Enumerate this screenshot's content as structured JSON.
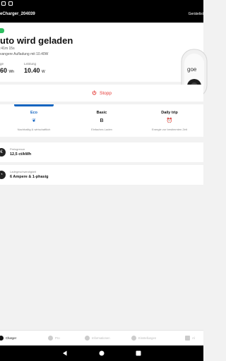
{
  "appbar": {
    "title": "eCharger_204039",
    "right_label": "Gerätelist"
  },
  "hero": {
    "title": "uto wird geladen",
    "elapsed": ":41m 15s",
    "info": "vangere Aufladung mit 10.40W",
    "stat1_label": "ge",
    "stat1_value": "60",
    "stat1_unit": "Wh",
    "stat2_label": "Leistung",
    "stat2_value": "10.40",
    "stat2_unit": "W",
    "device_brand": "goe"
  },
  "stop": {
    "label": "Stopp"
  },
  "modes": [
    {
      "name": "Eco",
      "icon": "leaf-icon",
      "glyph": "❦",
      "desc": "Nachhaltig & wirtschaftlich",
      "active": true
    },
    {
      "name": "Basic",
      "icon": "b-icon",
      "glyph": "B",
      "desc": "Einfaches Laden",
      "active": false
    },
    {
      "name": "Daily trip",
      "icon": "alarm-clock-icon",
      "glyph": "⏰",
      "desc": "Energie zur bestimmten Zeit",
      "active": false
    }
  ],
  "cards": {
    "price_label": "Preisgrenze",
    "price_value": "12,5 ct/kWh",
    "speed_label": "Ladegeschwindigkeit",
    "speed_value": "6 Ampere & 1-phasig"
  },
  "nav": {
    "charger": "Charger",
    "pro": "Pro",
    "info": "Informationen",
    "settings": "Einstellungen",
    "last": "Al"
  },
  "colors": {
    "stop_red": "#e53935",
    "active_blue": "#1565c0",
    "status_green": "#2ebd5f"
  }
}
